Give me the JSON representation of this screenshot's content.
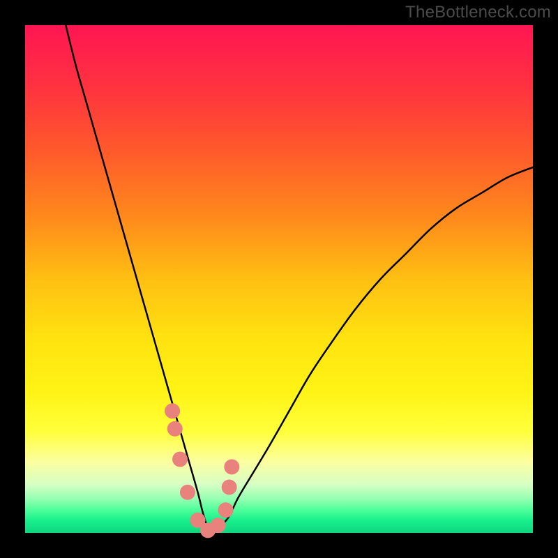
{
  "watermark": "TheBottleneck.com",
  "chart_data": {
    "type": "line",
    "title": "",
    "xlabel": "",
    "ylabel": "",
    "xlim": [
      0,
      100
    ],
    "ylim": [
      0,
      100
    ],
    "background_gradient": {
      "stops": [
        {
          "offset": 0.0,
          "color": "#ff1552"
        },
        {
          "offset": 0.12,
          "color": "#ff3240"
        },
        {
          "offset": 0.25,
          "color": "#ff5a2b"
        },
        {
          "offset": 0.38,
          "color": "#ff8a1c"
        },
        {
          "offset": 0.5,
          "color": "#ffbf12"
        },
        {
          "offset": 0.62,
          "color": "#ffe310"
        },
        {
          "offset": 0.72,
          "color": "#fff315"
        },
        {
          "offset": 0.8,
          "color": "#ffff3a"
        },
        {
          "offset": 0.86,
          "color": "#fcffa0"
        },
        {
          "offset": 0.905,
          "color": "#d6ffc4"
        },
        {
          "offset": 0.935,
          "color": "#8fffb0"
        },
        {
          "offset": 0.955,
          "color": "#4dff9a"
        },
        {
          "offset": 0.975,
          "color": "#18f08c"
        },
        {
          "offset": 1.0,
          "color": "#0fd67f"
        }
      ]
    },
    "series": [
      {
        "name": "bottleneck-curve",
        "type": "line",
        "stroke": "#000000",
        "stroke_width": 2.5,
        "x": [
          8,
          10,
          12,
          14,
          16,
          18,
          20,
          22,
          24,
          26,
          28,
          30,
          32,
          34,
          35,
          36,
          37,
          38,
          40,
          42,
          45,
          48,
          52,
          56,
          60,
          65,
          70,
          75,
          80,
          85,
          90,
          95,
          100
        ],
        "values": [
          100,
          92,
          85,
          78,
          71,
          64,
          57,
          50,
          43,
          36,
          29,
          22,
          15,
          8,
          4,
          1,
          0,
          1,
          3,
          7,
          12,
          17,
          24,
          31,
          37,
          44,
          50,
          55,
          60,
          64,
          67,
          70,
          72
        ]
      },
      {
        "name": "highlight-markers",
        "type": "scatter",
        "radius": 11,
        "fill": "#e9817c",
        "x": [
          29.0,
          29.5,
          30.5,
          32.0,
          34.0,
          36.0,
          38.0,
          39.5,
          40.2,
          40.7
        ],
        "values": [
          24.0,
          20.5,
          14.5,
          8.0,
          2.5,
          0.5,
          1.5,
          4.5,
          9.0,
          13.0
        ]
      }
    ]
  }
}
